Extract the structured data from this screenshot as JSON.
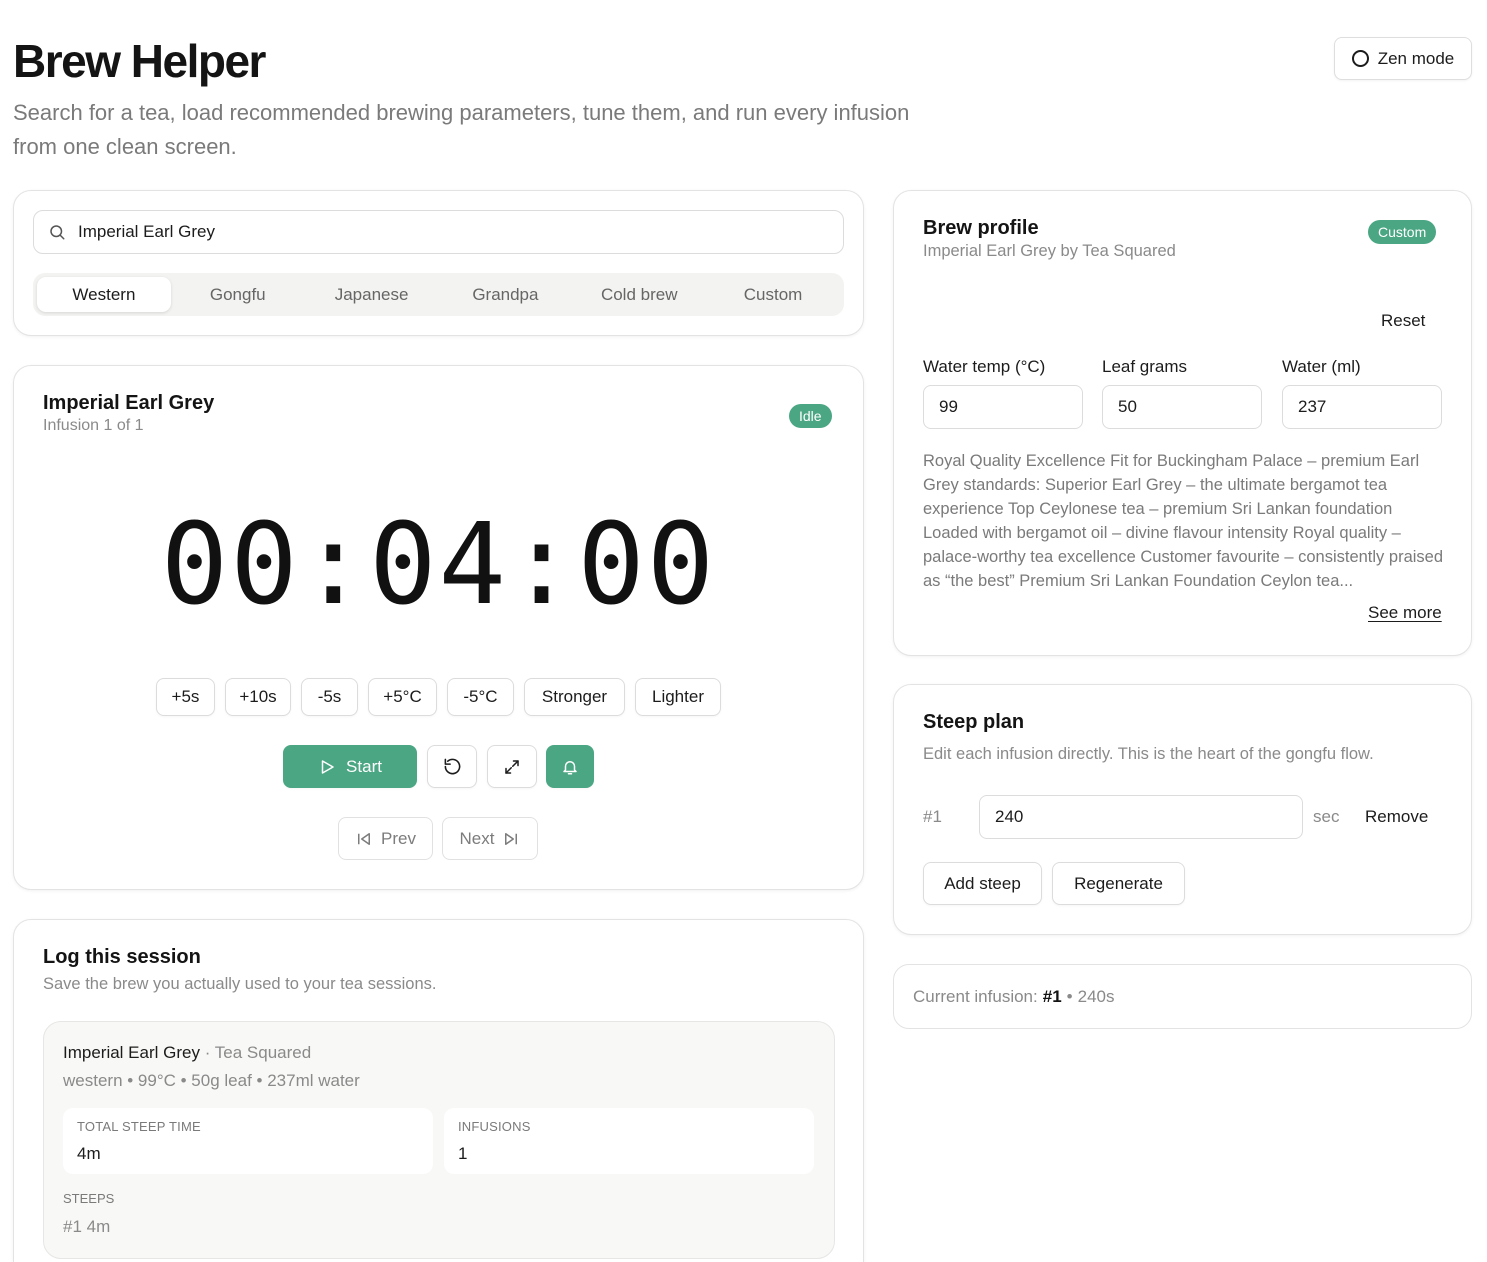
{
  "header": {
    "title": "Brew Helper",
    "subtitle": "Search for a tea, load recommended brewing parameters, tune them, and run every infusion from one clean screen.",
    "zen_label": "Zen mode"
  },
  "search": {
    "value": "Imperial Earl Grey",
    "placeholder": "Search for a tea"
  },
  "styles": {
    "tabs": [
      "Western",
      "Gongfu",
      "Japanese",
      "Grandpa",
      "Cold brew",
      "Custom"
    ],
    "active": "Western"
  },
  "timer_card": {
    "tea_name": "Imperial Earl Grey",
    "infusion_text": "Infusion 1 of 1",
    "status": "Idle",
    "hours": "00",
    "minutes": "04",
    "seconds": "00",
    "separator": ":",
    "adjust_buttons": [
      "+5s",
      "+10s",
      "-5s",
      "+5°C",
      "-5°C",
      "Stronger",
      "Lighter"
    ],
    "start_label": "Start",
    "prev_label": "Prev",
    "next_label": "Next"
  },
  "profile": {
    "title": "Brew profile",
    "subtitle": "Imperial Earl Grey by Tea Squared",
    "badge": "Custom",
    "reset_label": "Reset",
    "temp_label": "Water temp (°C)",
    "temp_value": "99",
    "leaf_label": "Leaf grams",
    "leaf_value": "50",
    "water_label": "Water (ml)",
    "water_value": "237",
    "description": "Royal Quality Excellence Fit for Buckingham Palace – premium Earl Grey standards: Superior Earl Grey – the ultimate bergamot tea experience Top Ceylonese tea – premium Sri Lankan foundation Loaded with bergamot oil – divine flavour intensity Royal quality – palace-worthy tea excellence Customer favourite – consistently praised as “the best” Premium Sri Lankan Foundation Ceylon tea...",
    "see_more_label": "See more"
  },
  "steep_plan": {
    "title": "Steep plan",
    "subtitle": "Edit each infusion directly. This is the heart of the gongfu flow.",
    "steeps": [
      {
        "index": "#1",
        "value": "240",
        "unit": "sec",
        "remove_label": "Remove"
      }
    ],
    "add_label": "Add steep",
    "regenerate_label": "Regenerate"
  },
  "current": {
    "label": "Current infusion:",
    "index": "#1",
    "sep": "•",
    "duration": "240s"
  },
  "log": {
    "title": "Log this session",
    "subtitle": "Save the brew you actually used to your tea sessions.",
    "tea_name": "Imperial Earl Grey",
    "brand": "· Tea Squared",
    "params": "western • 99°C • 50g leaf • 237ml water",
    "total_label": "TOTAL STEEP TIME",
    "total_value": "4m",
    "infusions_label": "INFUSIONS",
    "infusions_value": "1",
    "steeps_label": "STEEPS",
    "steeps_value": "#1 4m"
  },
  "colors": {
    "accent": "#4aa683",
    "text": "#1c1c1c",
    "muted": "#7a7a7a",
    "border": "#e3e3e3"
  },
  "icons": {
    "zen": "circle-icon",
    "search": "search-icon",
    "start": "play-icon",
    "reset": "rotate-ccw-icon",
    "fullscreen": "maximize-icon",
    "alarm": "bell-icon",
    "prev": "skip-back-icon",
    "next": "skip-forward-icon"
  }
}
